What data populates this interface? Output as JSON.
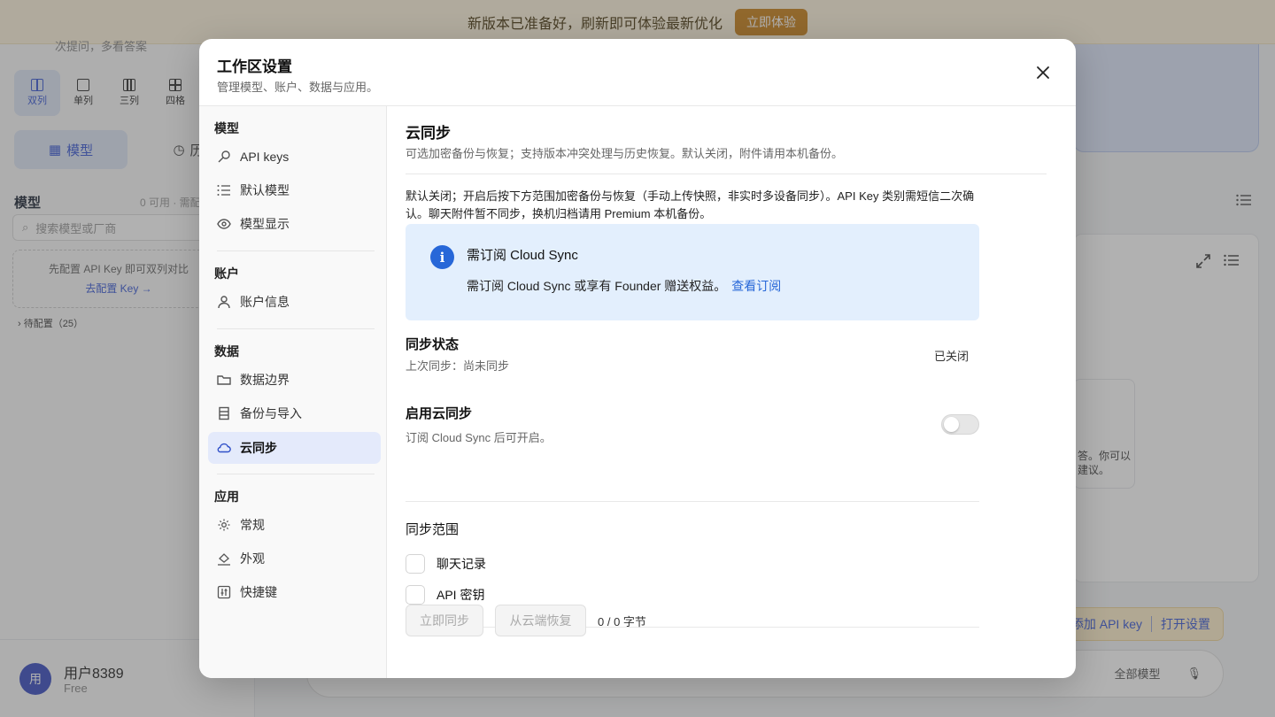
{
  "banner": {
    "text": "新版本已准备好，刷新即可体验最新优化",
    "cta": "立即体验"
  },
  "sidebar": {
    "hint": "次提问，多看答案",
    "layouts": [
      {
        "label": "双列",
        "active": true
      },
      {
        "label": "单列",
        "active": false
      },
      {
        "label": "三列",
        "active": false
      },
      {
        "label": "四格",
        "active": false
      }
    ],
    "tabs": {
      "models": "模型",
      "history": "历史"
    },
    "section_title": "模型",
    "section_meta": "0 可用 · 需配",
    "search_placeholder": "搜索模型或厂商",
    "empty_hint": "先配置 API Key 即可双列对比",
    "empty_link": "去配置 Key →",
    "pending": "待配置（25）",
    "user": {
      "avatar": "用",
      "name": "用户8389",
      "plan": "Free"
    }
  },
  "main": {
    "card_text": "答。你可以 建议。",
    "actions": {
      "add_key": "添加 API key",
      "open_settings": "打开设置"
    },
    "composer_models": "全部模型"
  },
  "modal": {
    "title": "工作区设置",
    "subtitle": "管理模型、账户、数据与应用。",
    "nav": {
      "groups": [
        {
          "title": "模型",
          "items": [
            {
              "label": "API keys",
              "icon": "key-icon"
            },
            {
              "label": "默认模型",
              "icon": "list-icon"
            },
            {
              "label": "模型显示",
              "icon": "eye-icon"
            }
          ]
        },
        {
          "title": "账户",
          "items": [
            {
              "label": "账户信息",
              "icon": "user-icon"
            }
          ]
        },
        {
          "title": "数据",
          "items": [
            {
              "label": "数据边界",
              "icon": "folder-icon"
            },
            {
              "label": "备份与导入",
              "icon": "archive-icon"
            },
            {
              "label": "云同步",
              "icon": "cloud-icon",
              "active": true
            }
          ]
        },
        {
          "title": "应用",
          "items": [
            {
              "label": "常规",
              "icon": "gear-icon"
            },
            {
              "label": "外观",
              "icon": "paint-bucket-icon"
            },
            {
              "label": "快捷键",
              "icon": "sliders-icon"
            }
          ]
        }
      ]
    },
    "content": {
      "title": "云同步",
      "description": "可选加密备份与恢复；支持版本冲突处理与历史恢复。默认关闭，附件请用本机备份。",
      "note": "默认关闭；开启后按下方范围加密备份与恢复（手动上传快照，非实时多设备同步）。API Key 类别需短信二次确认。聊天附件暂不同步，换机归档请用 Premium 本机备份。",
      "info": {
        "title": "需订阅 Cloud Sync",
        "body": "需订阅 Cloud Sync 或享有 Founder 赠送权益。",
        "link": "查看订阅"
      },
      "status": {
        "title": "同步状态",
        "last_sync": "上次同步：尚未同步",
        "value": "已关闭"
      },
      "enable": {
        "title": "启用云同步",
        "hint": "订阅 Cloud Sync 后可开启。",
        "on": false
      },
      "scope": {
        "title": "同步范围",
        "options": [
          {
            "label": "聊天记录",
            "checked": false
          },
          {
            "label": "API 密钥",
            "checked": false
          }
        ]
      },
      "actions": {
        "sync_now": "立即同步",
        "restore": "从云端恢复",
        "bytes": "0 / 0 字节"
      }
    }
  }
}
